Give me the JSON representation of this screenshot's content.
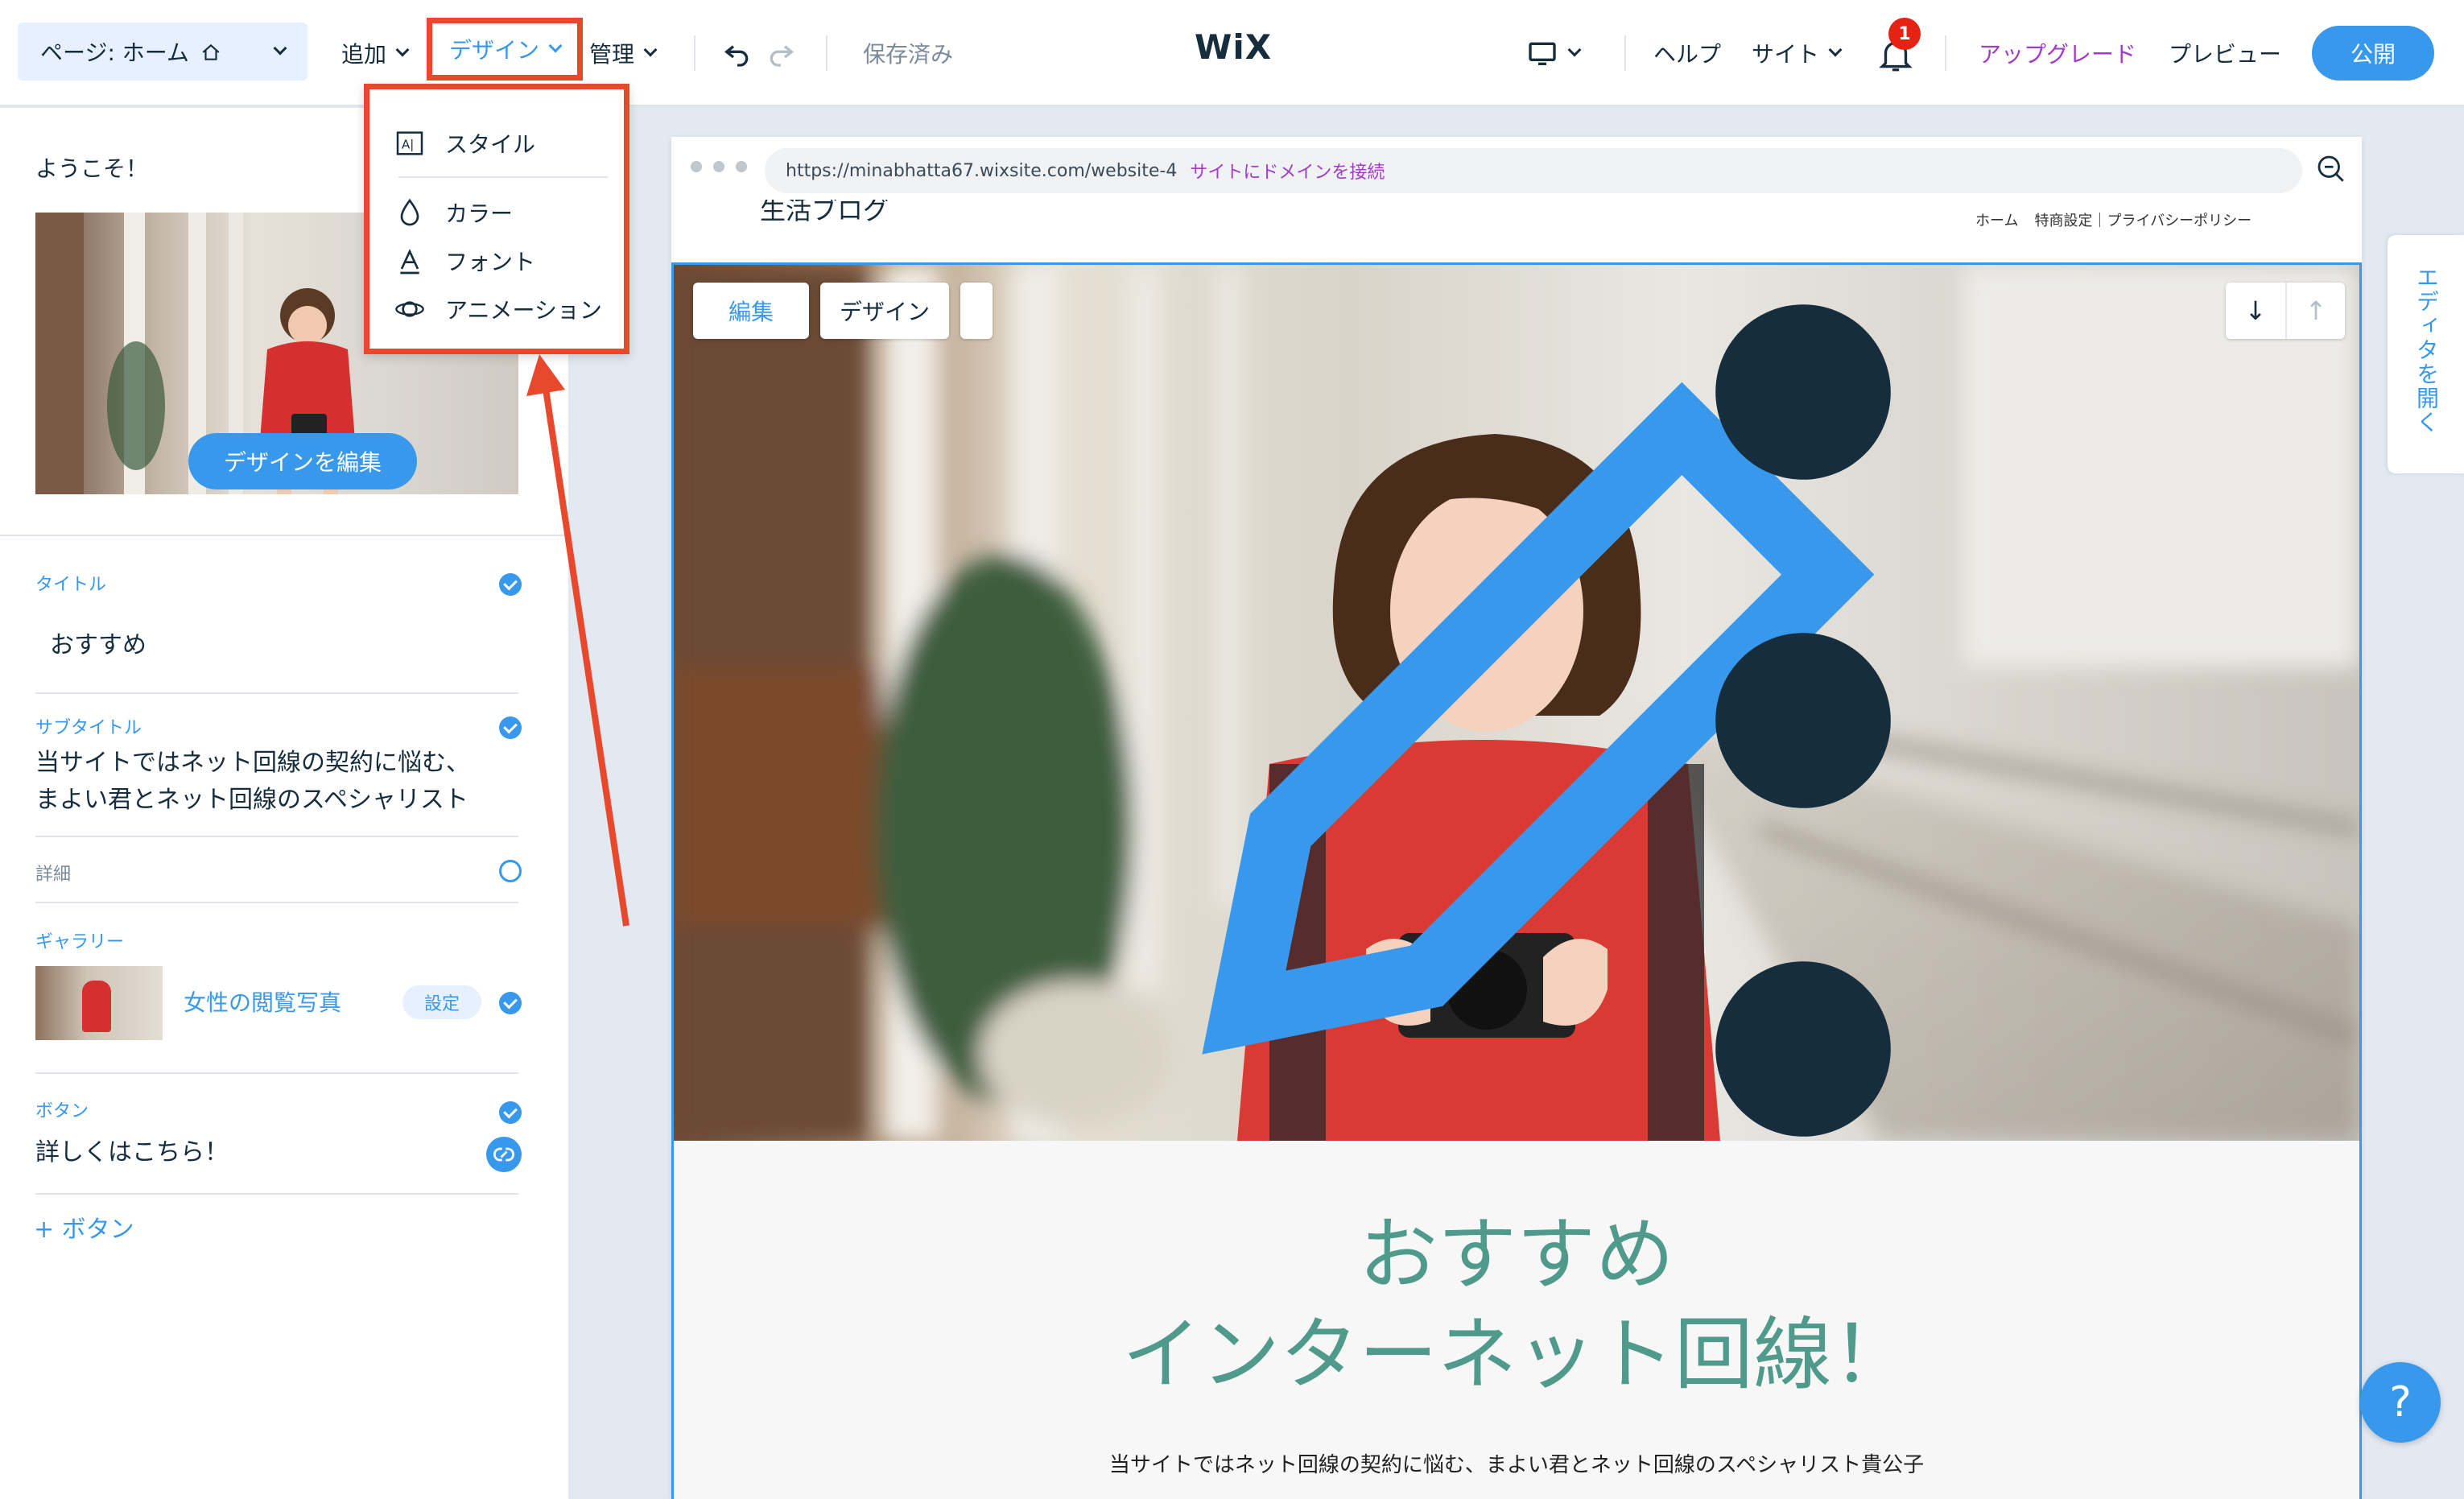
{
  "topbar": {
    "page_select": "ページ: ホーム",
    "add": "追加",
    "design": "デザイン",
    "manage": "管理",
    "saved": "保存済み",
    "logo": "WiX",
    "help": "ヘルプ",
    "site": "サイト",
    "notification_count": "1",
    "upgrade": "アップグレード",
    "preview": "プレビュー",
    "publish": "公開"
  },
  "design_menu": {
    "items": [
      {
        "label": "スタイル",
        "icon": "style-icon"
      },
      {
        "label": "カラー",
        "icon": "color-drop-icon"
      },
      {
        "label": "フォント",
        "icon": "font-icon"
      },
      {
        "label": "アニメーション",
        "icon": "animation-icon"
      }
    ]
  },
  "left_panel": {
    "welcome": "ようこそ！",
    "edit_design_button": "デザインを編集",
    "title_label": "タイトル",
    "title_value": "おすすめ",
    "subtitle_label": "サブタイトル",
    "subtitle_line1": "当サイトではネット回線の契約に悩む、",
    "subtitle_line2": "まよい君とネット回線のスペシャリスト",
    "details_label": "詳細",
    "gallery_label": "ギャラリー",
    "gallery_item": "女性の閲覧写真",
    "gallery_settings": "設定",
    "button_label": "ボタン",
    "button_value": "詳しくはこちら！",
    "add_button": "+ ボタン"
  },
  "canvas": {
    "url": "https://minabhatta67.wixsite.com/website-4",
    "connect_domain": "サイトにドメインを接続",
    "site_logo": "生活ブログ",
    "site_nav": [
      "ホーム",
      "特商設定｜プライバシーポリシー"
    ],
    "hero_edit": "編集",
    "hero_design": "デザイン",
    "headline_line1": "おすすめ",
    "headline_line2": "インターネット回線！",
    "sub_text": "当サイトではネット回線の契約に悩む、まよい君とネット回線のスペシャリスト貴公子"
  },
  "side": {
    "open_editor": "エディタを開く",
    "help": "?"
  },
  "colors": {
    "accent": "#3899ec",
    "highlight": "#e8492d",
    "headline": "#4f9a8b",
    "upgrade": "#a33aca"
  }
}
